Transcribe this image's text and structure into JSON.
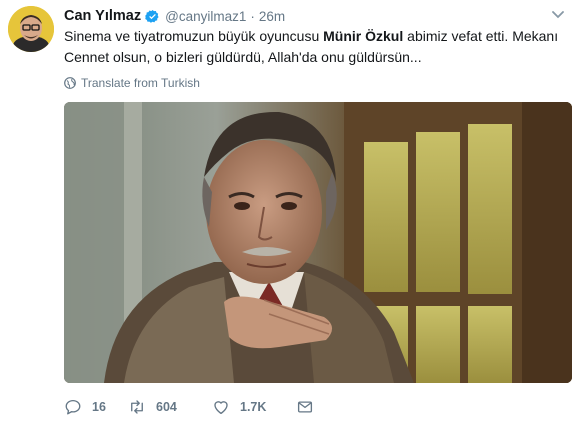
{
  "tweet": {
    "author_name": "Can Yılmaz",
    "handle": "@canyilmaz1",
    "separator": "·",
    "time": "26m",
    "text_before": "Sinema ve tiyatromuzun büyük oyuncusu ",
    "text_bold": "Münir Özkul",
    "text_after": " abimiz vefat etti. Mekanı Cennet olsun, o bizleri güldürdü, Allah'da onu güldürsün...",
    "translate_label": "Translate from Turkish",
    "stats": {
      "replies": "16",
      "retweets": "604",
      "likes": "1.7K"
    },
    "icons": {
      "verified": "verified-badge-icon",
      "caret": "chevron-down-icon",
      "translate": "globe-icon",
      "reply": "reply-icon",
      "retweet": "retweet-icon",
      "like": "heart-icon",
      "dm": "envelope-icon"
    },
    "colors": {
      "verified": "#1da1f2",
      "muted": "#657786",
      "text": "#14171a"
    }
  }
}
